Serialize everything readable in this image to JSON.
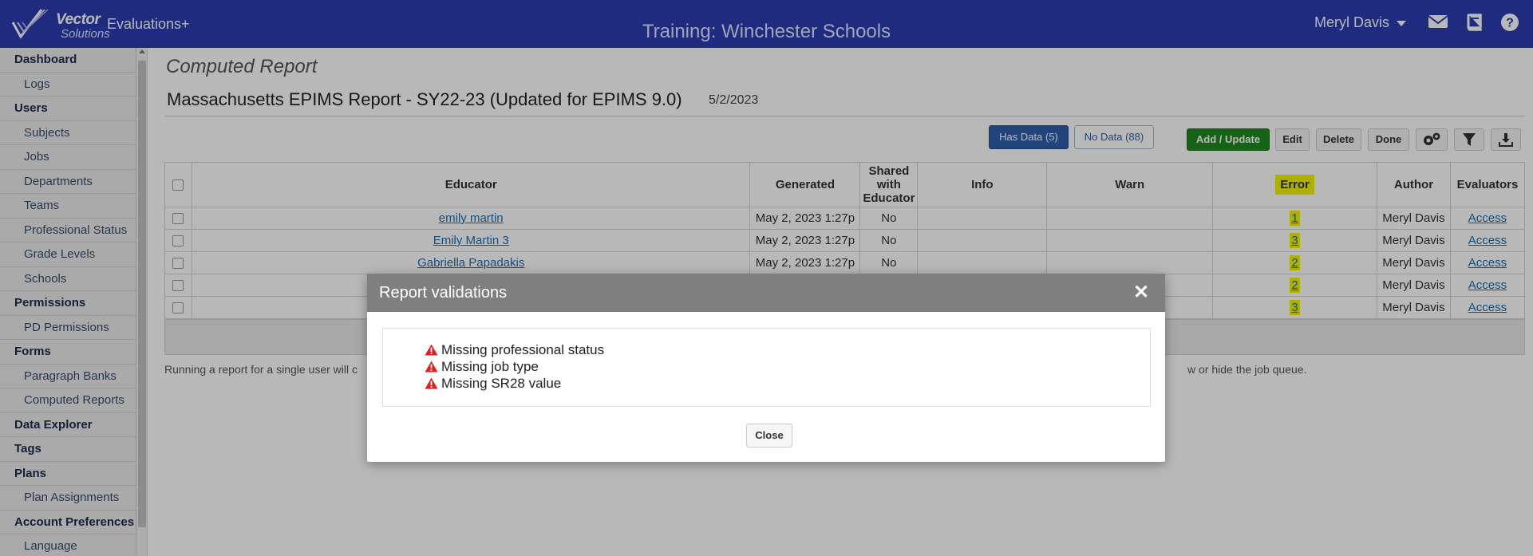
{
  "header": {
    "logo_line1": "Vector",
    "logo_line2": "Solutions",
    "app_name": "Evaluations+",
    "site_title": "Training: Winchester Schools",
    "user_name": "Meryl Davis",
    "icons": [
      "envelope-icon",
      "book-icon",
      "help-icon"
    ]
  },
  "sidebar": {
    "items": [
      {
        "label": "Dashboard",
        "type": "header"
      },
      {
        "label": "Logs",
        "type": "sub"
      },
      {
        "label": "Users",
        "type": "header"
      },
      {
        "label": "Subjects",
        "type": "sub"
      },
      {
        "label": "Jobs",
        "type": "sub"
      },
      {
        "label": "Departments",
        "type": "sub"
      },
      {
        "label": "Teams",
        "type": "sub"
      },
      {
        "label": "Professional Status",
        "type": "sub"
      },
      {
        "label": "Grade Levels",
        "type": "sub"
      },
      {
        "label": "Schools",
        "type": "sub"
      },
      {
        "label": "Permissions",
        "type": "header"
      },
      {
        "label": "PD Permissions",
        "type": "sub"
      },
      {
        "label": "Forms",
        "type": "header"
      },
      {
        "label": "Paragraph Banks",
        "type": "sub"
      },
      {
        "label": "Computed Reports",
        "type": "sub"
      },
      {
        "label": "Data Explorer",
        "type": "header"
      },
      {
        "label": "Tags",
        "type": "header"
      },
      {
        "label": "Plans",
        "type": "header"
      },
      {
        "label": "Plan Assignments",
        "type": "sub"
      },
      {
        "label": "Account Preferences",
        "type": "header"
      },
      {
        "label": "Language",
        "type": "sub"
      }
    ]
  },
  "main": {
    "subtitle": "Computed Report",
    "report_title": "Massachusetts EPIMS Report - SY22-23 (Updated for EPIMS 9.0)",
    "report_date": "5/2/2023",
    "toolbar": {
      "has_data": "Has Data (5)",
      "no_data": "No Data (88)",
      "add_update": "Add / Update",
      "edit": "Edit",
      "delete": "Delete",
      "done": "Done"
    },
    "table": {
      "columns": [
        "Educator",
        "Generated",
        "Shared with Educator",
        "Info",
        "Warn",
        "Error",
        "Author",
        "Evaluators"
      ],
      "rows": [
        {
          "educator": "emily martin",
          "generated": "May 2, 2023 1:27p",
          "shared": "No",
          "info": "",
          "warn": "",
          "error": "1",
          "author": "Meryl Davis",
          "evaluators": "Access"
        },
        {
          "educator": "Emily Martin 3",
          "generated": "May 2, 2023 1:27p",
          "shared": "No",
          "info": "",
          "warn": "",
          "error": "3",
          "author": "Meryl Davis",
          "evaluators": "Access"
        },
        {
          "educator": "Gabriella Papadakis",
          "generated": "May 2, 2023 1:27p",
          "shared": "No",
          "info": "",
          "warn": "",
          "error": "2",
          "author": "Meryl Davis",
          "evaluators": "Access"
        },
        {
          "educator": "",
          "generated": "",
          "shared": "",
          "info": "",
          "warn": "",
          "error": "2",
          "author": "Meryl Davis",
          "evaluators": "Access"
        },
        {
          "educator": "",
          "generated": "",
          "shared": "",
          "info": "",
          "warn": "",
          "error": "3",
          "author": "Meryl Davis",
          "evaluators": "Access"
        }
      ]
    },
    "note_left": "Running a report for a single user will c",
    "note_right": "w or hide the job queue."
  },
  "modal": {
    "title": "Report validations",
    "close_symbol": "✕",
    "validations": [
      "Missing professional status",
      "Missing job type",
      "Missing SR28 value"
    ],
    "close_button": "Close"
  },
  "colors": {
    "topbar": "#2a3cb0",
    "error_highlight": "#f3f300",
    "primary_button": "#2e5faa",
    "success_button": "#1e8a1e",
    "warning_icon": "#e0201c"
  }
}
